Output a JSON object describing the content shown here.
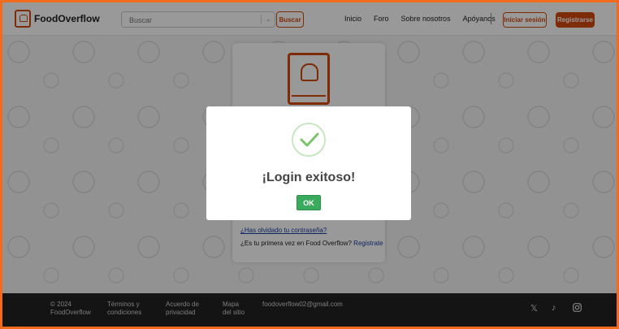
{
  "header": {
    "logo_text": "FoodOverflow",
    "search_placeholder": "Buscar",
    "search_button": "Buscar",
    "nav": [
      "Inicio",
      "Foro",
      "Sobre nosotros",
      "Apóyanos"
    ],
    "login_button": "Iniciar sesión",
    "register_button": "Registrarse"
  },
  "card": {
    "forgot_link": "¿Has olvidado tu contraseña?",
    "first_time_text": "¿Es tu primera vez en Food Overflow? ",
    "register_link": "Registrate"
  },
  "modal": {
    "title": "¡Login exitoso!",
    "ok_button": "OK"
  },
  "footer": {
    "copyright_line1": "© 2024",
    "copyright_line2": "FoodOverflow",
    "terms_line1": "Términos y",
    "terms_line2": "condiciones",
    "privacy_line1": "Acuerdo de",
    "privacy_line2": "privacidad",
    "sitemap_line1": "Mapa",
    "sitemap_line2": "del sitio",
    "email": "foodoverflow02@gmail.com",
    "icons": [
      "x-icon",
      "tiktok-icon",
      "instagram-icon"
    ]
  },
  "colors": {
    "accent": "#d24a0d",
    "success": "#3aaa5c",
    "frame": "#f26a1b"
  }
}
